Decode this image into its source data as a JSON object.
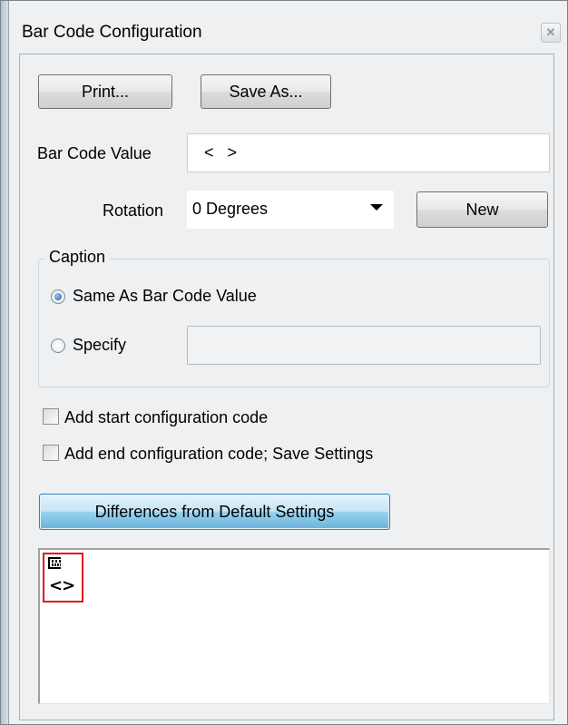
{
  "window": {
    "title": "Bar Code Configuration",
    "close_glyph": "✕"
  },
  "toolbar": {
    "print_label": "Print...",
    "save_as_label": "Save As..."
  },
  "bar_code_value": {
    "label": "Bar Code Value",
    "value": "<   >"
  },
  "rotation": {
    "label": "Rotation",
    "selected": "0 Degrees",
    "new_label": "New"
  },
  "caption": {
    "legend": "Caption",
    "same_as_label": "Same As Bar Code Value",
    "same_as_checked": true,
    "specify_label": "Specify",
    "specify_checked": false,
    "specify_value": ""
  },
  "options": {
    "start_code_label": "Add start configuration code",
    "start_code_checked": false,
    "end_code_label": "Add end configuration code; Save Settings",
    "end_code_checked": false
  },
  "differences_button_label": "Differences from Default Settings",
  "preview": {
    "caption_text": "<>"
  },
  "colors": {
    "accent": "#98d1ef",
    "highlight": "#e0151c"
  },
  "icons": [
    "close-icon",
    "dropdown-arrow-icon",
    "barcode-icon"
  ]
}
